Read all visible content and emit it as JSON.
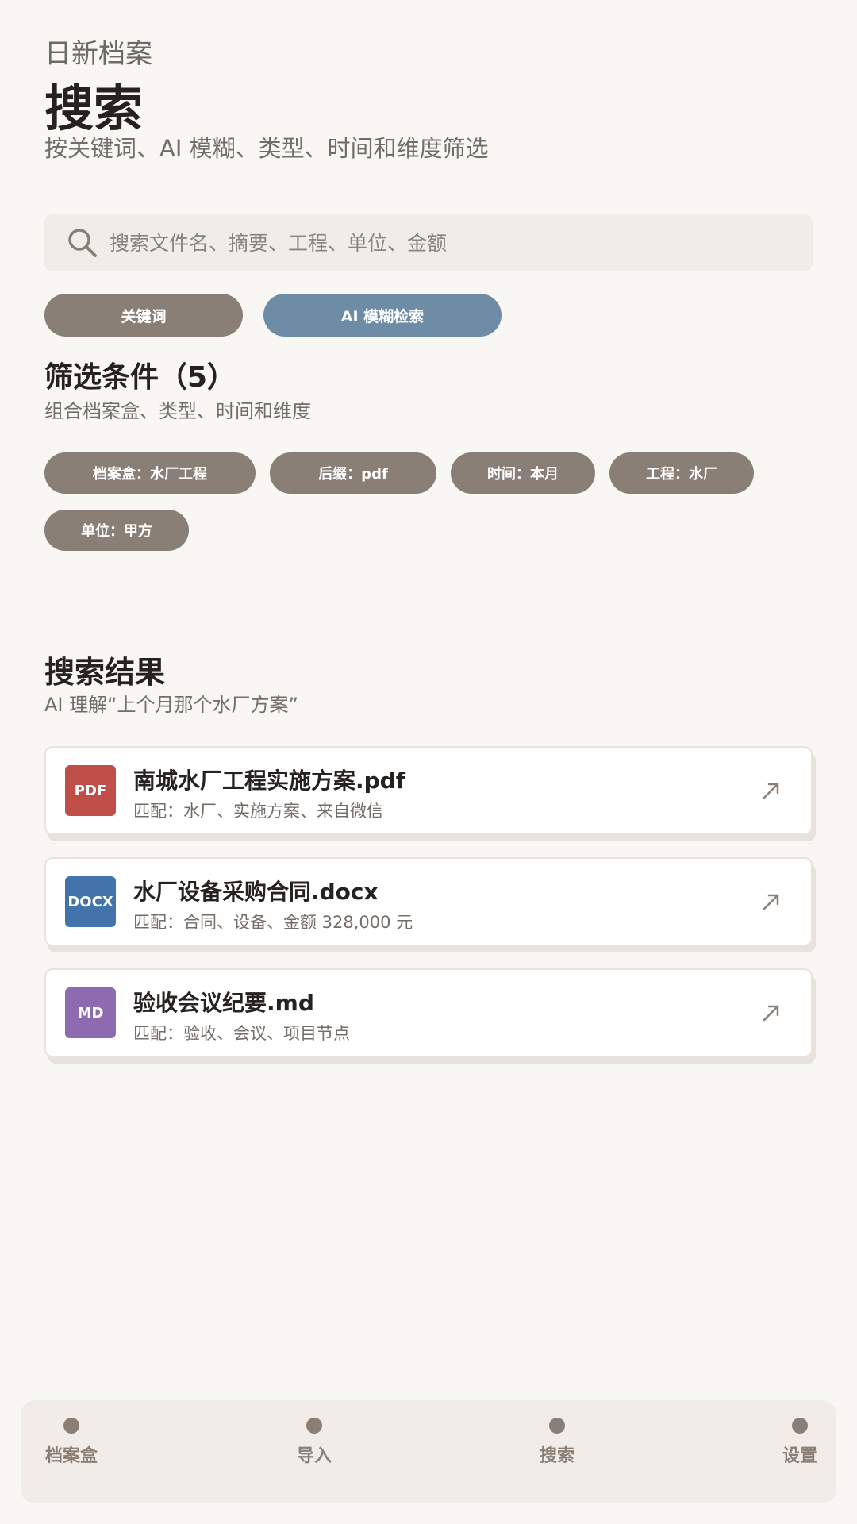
{
  "header": {
    "app_name": "日新档案",
    "title": "搜索",
    "subtitle": "按关键词、AI 模糊、类型、时间和维度筛选"
  },
  "search": {
    "placeholder": "搜索文件名、摘要、工程、单位、金额",
    "value": ""
  },
  "modes": {
    "keyword": "关键词",
    "ai": "AI 模糊检索"
  },
  "filters": {
    "title": "筛选条件（5）",
    "subtitle": "组合档案盒、类型、时间和维度",
    "chips": [
      "档案盒：水厂工程",
      "后缀：pdf",
      "时间：本月",
      "工程：水厂",
      "单位：甲方"
    ]
  },
  "results": {
    "title": "搜索结果",
    "subtitle": "AI 理解“上个月那个水厂方案”",
    "items": [
      {
        "badge": "PDF",
        "badge_color": "#bf4e48",
        "name": "南城水厂工程实施方案.pdf",
        "match": "匹配：水厂、实施方案、来自微信"
      },
      {
        "badge": "DOCX",
        "badge_color": "#4273ab",
        "name": "水厂设备采购合同.docx",
        "match": "匹配：合同、设备、金额 328,000 元"
      },
      {
        "badge": "MD",
        "badge_color": "#8e6bb0",
        "name": "验收会议纪要.md",
        "match": "匹配：验收、会议、项目节点"
      }
    ]
  },
  "nav": {
    "items": [
      "档案盒",
      "导入",
      "搜索",
      "设置"
    ]
  },
  "colors": {
    "background": "#f9f7f4",
    "chip": "#8a7f77",
    "ai_button": "#6f8ca7"
  }
}
